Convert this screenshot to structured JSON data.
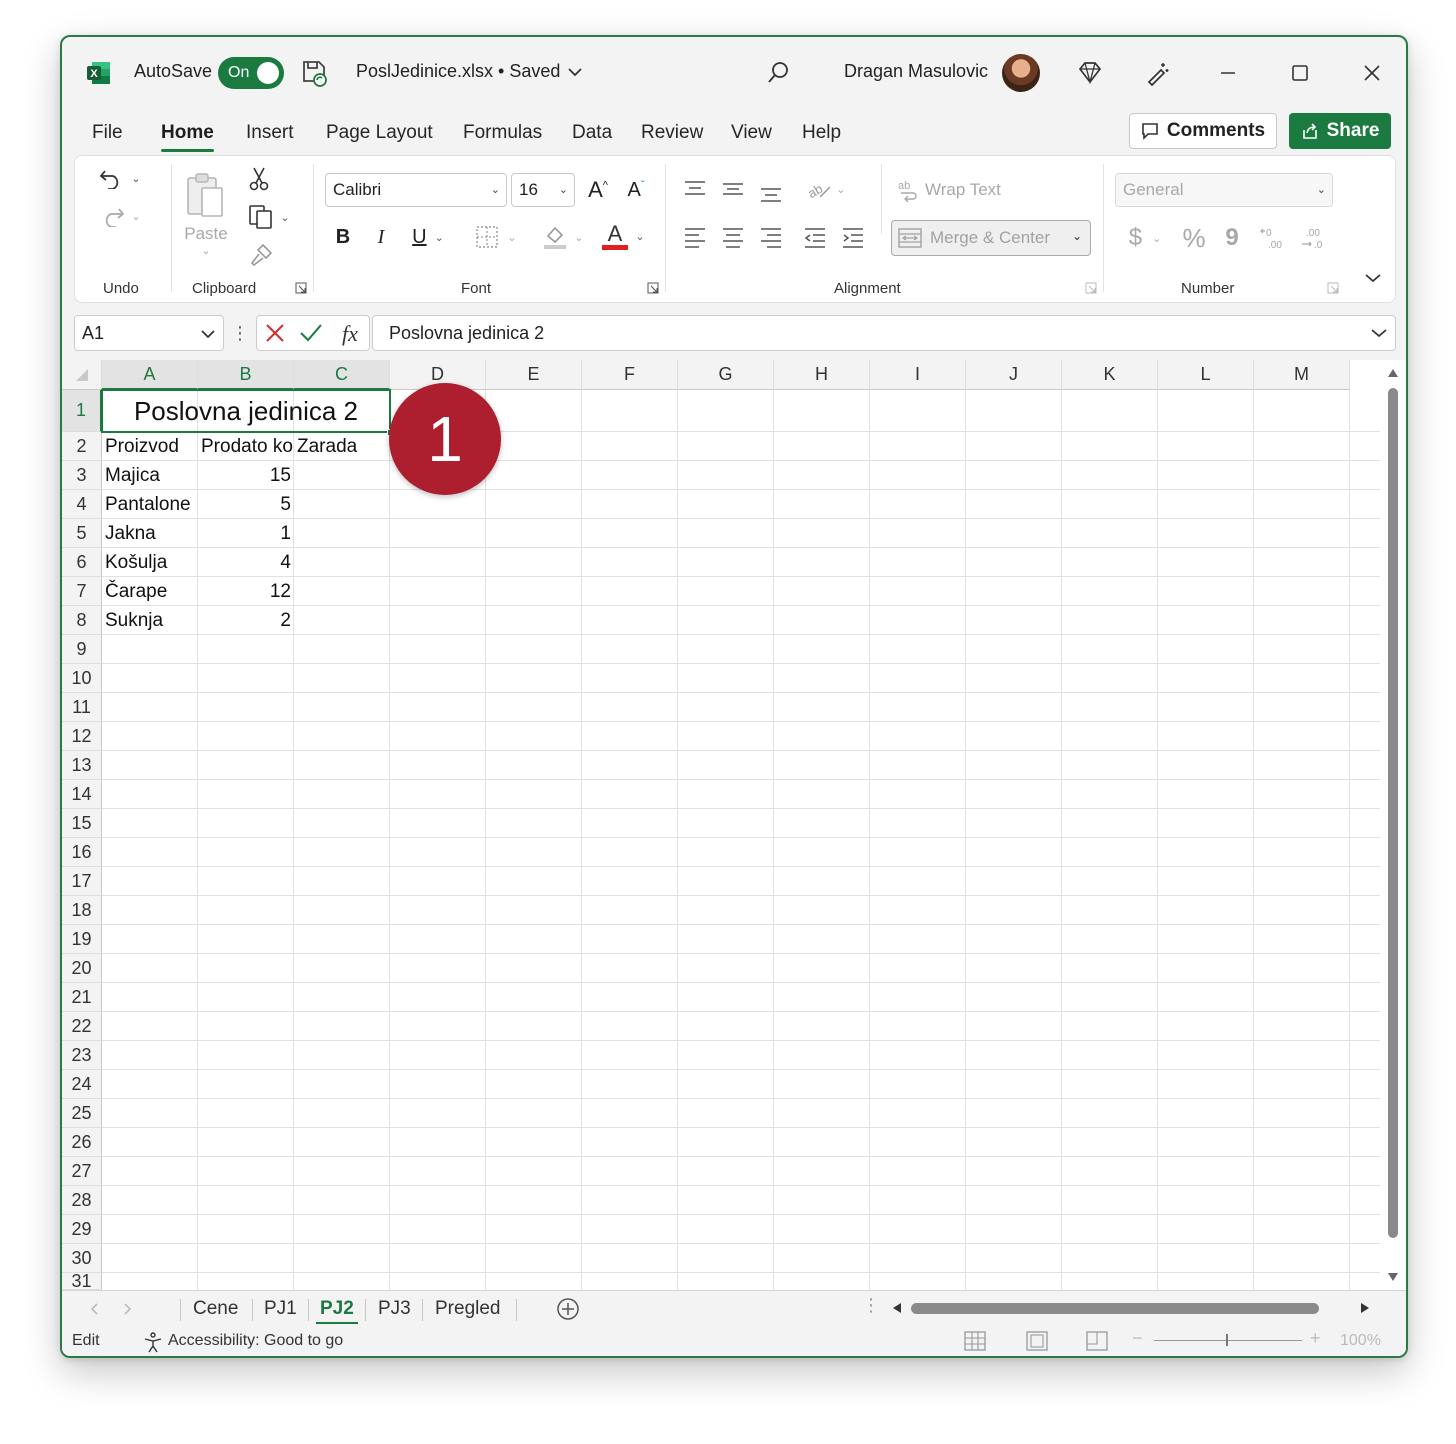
{
  "titlebar": {
    "autosave_label": "AutoSave",
    "autosave_state": "On",
    "file_title": "PoslJedinice.xlsx • Saved",
    "user_name": "Dragan Masulovic"
  },
  "menu": {
    "tabs": [
      "File",
      "Home",
      "Insert",
      "Page Layout",
      "Formulas",
      "Data",
      "Review",
      "View",
      "Help"
    ],
    "active_tab": "Home",
    "comments_label": "Comments",
    "share_label": "Share"
  },
  "ribbon": {
    "groups": {
      "undo": "Undo",
      "clipboard": "Clipboard",
      "font": "Font",
      "alignment": "Alignment",
      "number": "Number"
    },
    "paste_label": "Paste",
    "font_name": "Calibri",
    "font_size": "16",
    "wrap_text_label": "Wrap Text",
    "merge_center_label": "Merge & Center",
    "number_format": "General",
    "currency_symbol": "$",
    "percent_symbol": "%",
    "comma_symbol": "9"
  },
  "formula_bar": {
    "name_box": "A1",
    "fx_label": "fx",
    "formula": "Poslovna jedinica 2"
  },
  "grid": {
    "columns": [
      "A",
      "B",
      "C",
      "D",
      "E",
      "F",
      "G",
      "H",
      "I",
      "J",
      "K",
      "L",
      "M"
    ],
    "rows": [
      "1",
      "2",
      "3",
      "4",
      "5",
      "6",
      "7",
      "8",
      "9",
      "10",
      "11",
      "12",
      "13",
      "14",
      "15",
      "16",
      "17",
      "18",
      "19",
      "20",
      "21",
      "22",
      "23",
      "24",
      "25",
      "26",
      "27",
      "28",
      "29",
      "30",
      "31"
    ],
    "title_cell": "Poslovna jedinica 2",
    "headers": [
      "Proizvod",
      "Prodato ko",
      "Zarada"
    ],
    "data_rows": [
      {
        "product": "Majica",
        "sold": "15"
      },
      {
        "product": "Pantalone",
        "sold": "5"
      },
      {
        "product": "Jakna",
        "sold": "1"
      },
      {
        "product": "Košulja",
        "sold": "4"
      },
      {
        "product": "Čarape",
        "sold": "12"
      },
      {
        "product": "Suknja",
        "sold": "2"
      }
    ]
  },
  "callout_number": "1",
  "sheets": {
    "tabs": [
      "Cene",
      "PJ1",
      "PJ2",
      "PJ3",
      "Pregled"
    ],
    "active": "PJ2"
  },
  "status": {
    "mode": "Edit",
    "accessibility": "Accessibility: Good to go",
    "zoom": "100%"
  },
  "colors": {
    "excel_green": "#1a7a3f",
    "callout_red": "#ad1f2f",
    "font_color_bar": "#e02020"
  }
}
